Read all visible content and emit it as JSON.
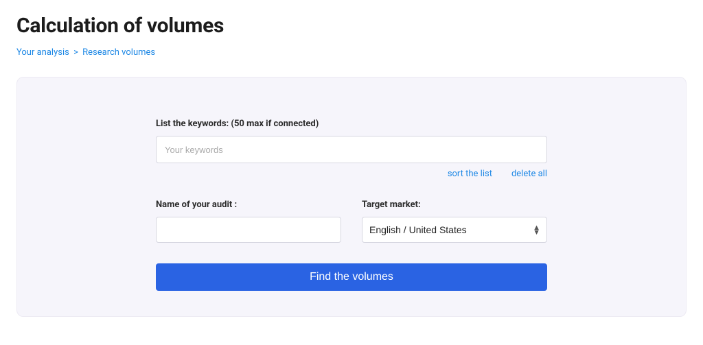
{
  "title": "Calculation of volumes",
  "breadcrumb": {
    "home": "Your analysis",
    "sep": ">",
    "current": "Research volumes"
  },
  "form": {
    "keywords_label": "List the keywords: (50 max if connected)",
    "keywords_placeholder": "Your keywords",
    "keywords_value": "",
    "sort_link": "sort the list",
    "delete_link": "delete all",
    "audit_label": "Name of your audit :",
    "audit_value": "",
    "market_label": "Target market:",
    "market_selected": "English / United States",
    "submit_label": "Find the volumes"
  }
}
